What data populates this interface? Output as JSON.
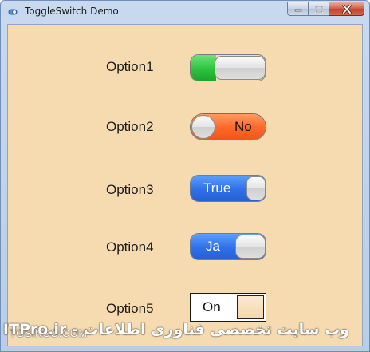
{
  "window": {
    "title": "ToggleSwitch Demo",
    "caption_min": "–",
    "caption_max": "□",
    "caption_close": "✕"
  },
  "options": [
    {
      "label": "Option1",
      "switch_text": "",
      "state": "on",
      "track_color": "#2fc33e"
    },
    {
      "label": "Option2",
      "switch_text": "No",
      "state": "off",
      "track_color": "#ff6a2b"
    },
    {
      "label": "Option3",
      "switch_text": "True",
      "state": "on",
      "track_color": "#2f6fe8"
    },
    {
      "label": "Option4",
      "switch_text": "Ja",
      "state": "on",
      "track_color": "#2f6fe8"
    },
    {
      "label": "Option5",
      "switch_text": "On",
      "state": "on",
      "track_color": "#ffffff"
    }
  ],
  "watermark": {
    "left": "TOSINSO.COM",
    "right": "ITPro.ir - وب سایت تخصصی فناوری اطلاعات"
  },
  "colors": {
    "client_background": "#f7dbb0",
    "frame": "#b9cde6",
    "close_button": "#c4412a"
  }
}
